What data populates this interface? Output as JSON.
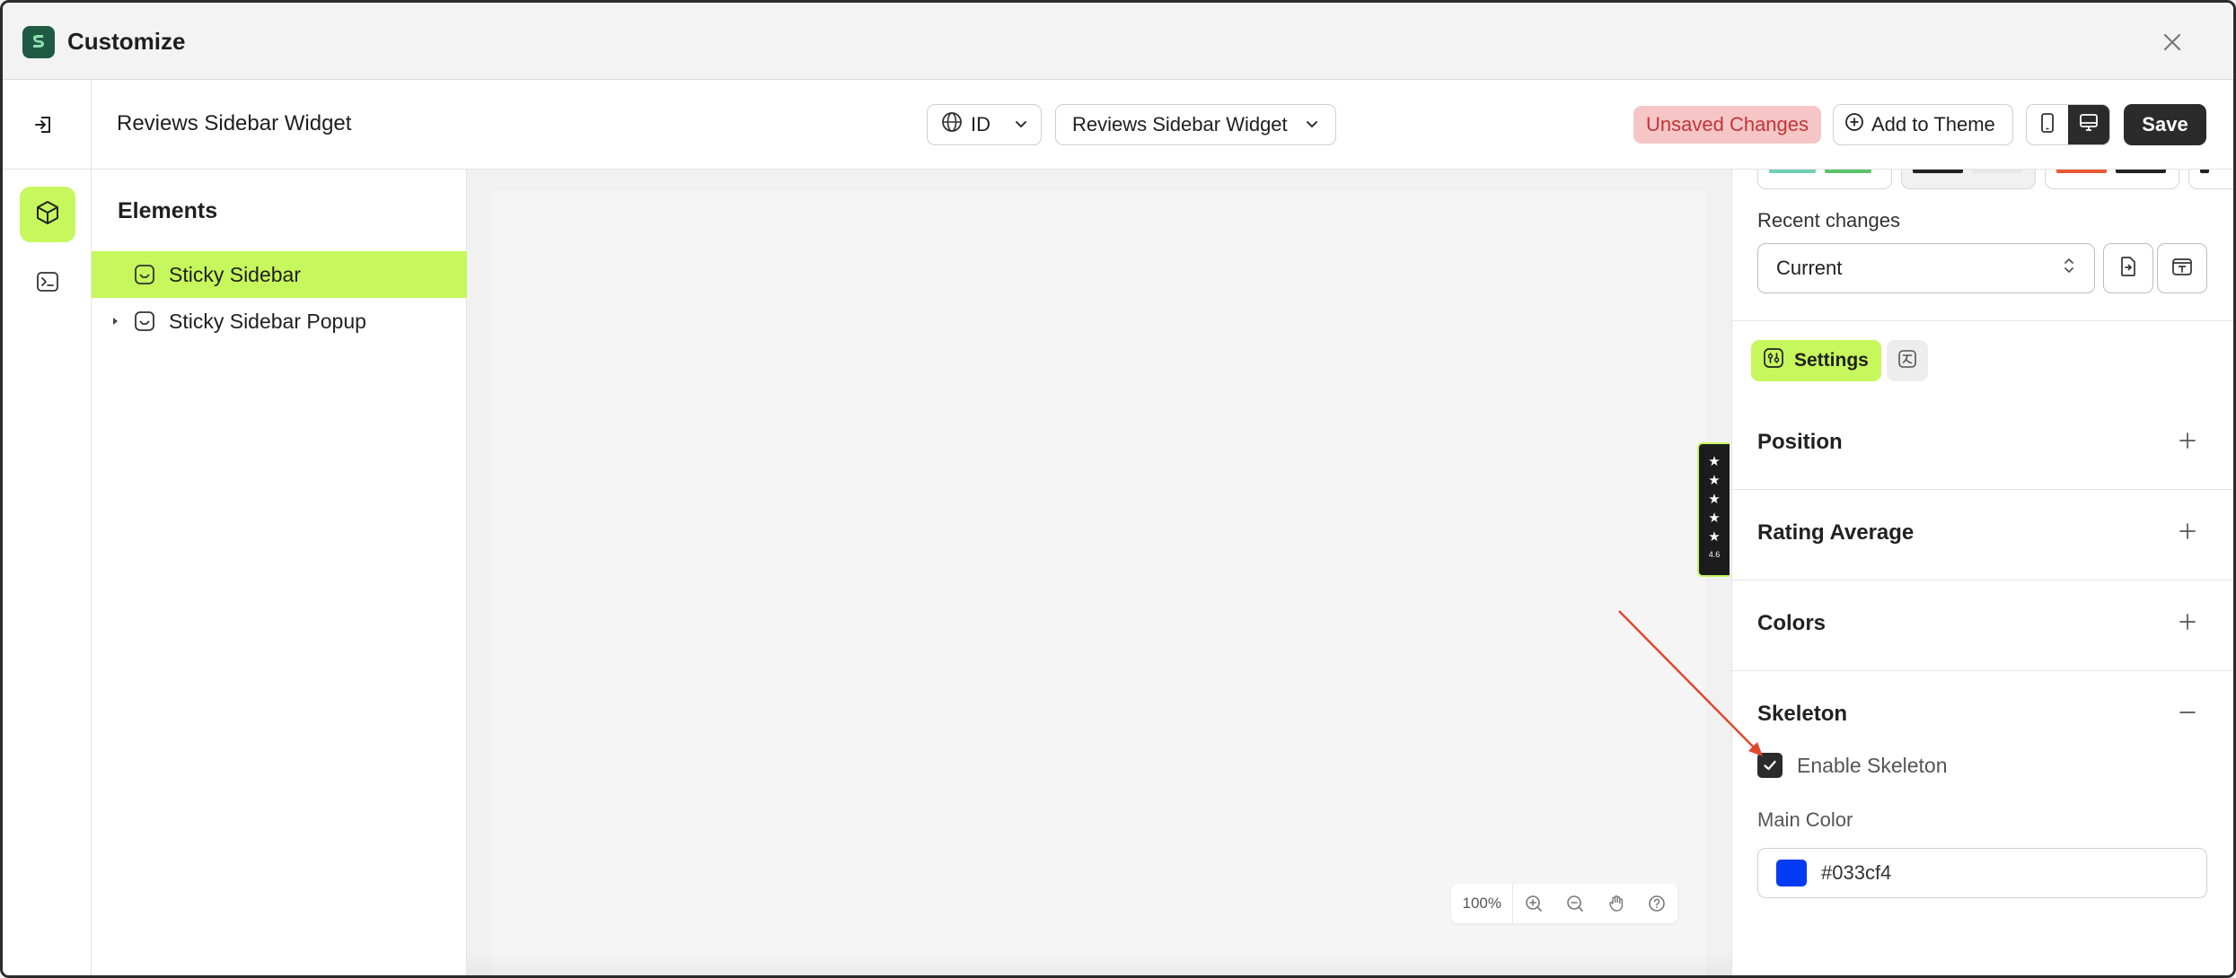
{
  "app": {
    "title": "Customize"
  },
  "toolbar": {
    "page_name": "Reviews Sidebar Widget",
    "language": "ID",
    "widget_select": "Reviews Sidebar Widget",
    "unsaved": "Unsaved Changes",
    "add_to_theme": "Add to Theme",
    "save": "Save"
  },
  "elements": {
    "title": "Elements",
    "items": [
      {
        "label": "Sticky Sidebar",
        "selected": true
      },
      {
        "label": "Sticky Sidebar Popup",
        "selected": false
      }
    ]
  },
  "canvas": {
    "rating_score": "4.6",
    "rating_stars": 5,
    "zoom": "100%"
  },
  "settings": {
    "recent_label": "Recent changes",
    "recent_value": "Current",
    "tab_settings": "Settings",
    "sections": [
      {
        "title": "Position",
        "expanded": false
      },
      {
        "title": "Rating Average",
        "expanded": false
      },
      {
        "title": "Colors",
        "expanded": false
      },
      {
        "title": "Skeleton",
        "expanded": true
      }
    ],
    "enable_skeleton_label": "Enable Skeleton",
    "enable_skeleton_checked": true,
    "main_color_label": "Main Color",
    "main_color_value": "#033cf4"
  },
  "colors": {
    "accent": "#c6f75c",
    "dark": "#2b2b2b",
    "unsaved_bg": "#f6c6c6",
    "unsaved_text": "#c23434",
    "annotation_arrow": "#e0472b"
  }
}
